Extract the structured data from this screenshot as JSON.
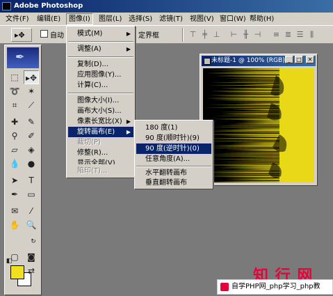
{
  "app": {
    "title": "Adobe Photoshop"
  },
  "menubar": {
    "items": [
      {
        "label": "文件(F)"
      },
      {
        "label": "编辑(E)"
      },
      {
        "label": "图像(I)"
      },
      {
        "label": "图层(L)"
      },
      {
        "label": "选择(S)"
      },
      {
        "label": "滤镜(T)"
      },
      {
        "label": "视图(V)"
      },
      {
        "label": "窗口(W)"
      },
      {
        "label": "帮助(H)"
      }
    ]
  },
  "options": {
    "auto_select": "自动",
    "bbox_label": "定界框"
  },
  "document": {
    "title": "未标题-1 @ 100% (RGB)"
  },
  "image_menu": {
    "items": [
      {
        "label": "模式(M)",
        "sub": true
      },
      {
        "label": "调整(A)",
        "sub": true
      },
      {
        "label": "复制(D)..."
      },
      {
        "label": "应用图像(Y)..."
      },
      {
        "label": "计算(C)..."
      },
      {
        "label": "图像大小(I)..."
      },
      {
        "label": "画布大小(S)..."
      },
      {
        "label": "像素长宽比(X)",
        "sub": true
      },
      {
        "label": "旋转画布(E)",
        "sub": true
      },
      {
        "label": "裁切(P)"
      },
      {
        "label": "修整(R)..."
      },
      {
        "label": "显示全部(V)"
      },
      {
        "label": "陷印(T)..."
      }
    ]
  },
  "rotate_menu": {
    "items": [
      {
        "label": "180 度(1)"
      },
      {
        "label": "90 度(顺时针)(9)"
      },
      {
        "label": "90 度(逆时针)(0)"
      },
      {
        "label": "任意角度(A)..."
      },
      {
        "label": "水平翻转画布"
      },
      {
        "label": "垂直翻转画布"
      }
    ]
  },
  "colors": {
    "foreground": "#f0e020",
    "background": "#ffffff",
    "highlight": "#0a246a"
  },
  "watermark": {
    "text": "知 行 网"
  },
  "footer": {
    "text": "自学PHP网_php学习_php教"
  }
}
